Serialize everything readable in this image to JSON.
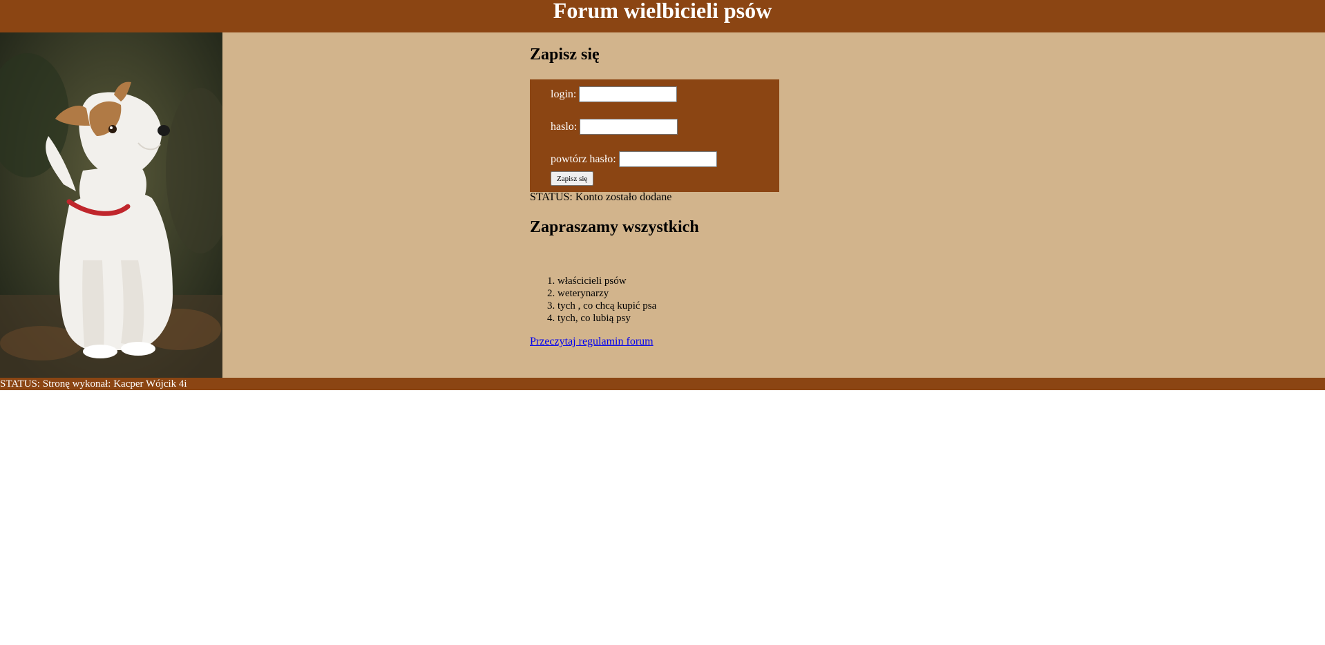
{
  "banner": {
    "title": "Forum wielbicieli psów"
  },
  "photo": {
    "icon": "dog-photo",
    "colors": {
      "background": "#3d3a28",
      "fur": "#f2f0ec",
      "tan": "#b07a45",
      "collar": "#c0262c"
    }
  },
  "signup": {
    "heading": "Zapisz się",
    "login_label": "login:",
    "login_value": "",
    "password_label": "haslo:",
    "password_value": "",
    "repeat_label": "powtórz hasło:",
    "repeat_value": "",
    "submit_label": "Zapisz się"
  },
  "status": {
    "message": "STATUS: Konto zostało dodane"
  },
  "welcome": {
    "heading": "Zapraszamy wszystkich",
    "items": [
      "właścicieli psów",
      "weterynarzy",
      "tych , co chcą kupić psa",
      "tych, co lubią psy"
    ],
    "link_label": "Przeczytaj regulamin forum"
  },
  "footer": {
    "text": "STATUS: Stronę wykonał: Kacper Wójcik 4i"
  },
  "colors": {
    "brown": "#8b4513",
    "tan": "#d2b48c",
    "link": "#0000ee"
  }
}
